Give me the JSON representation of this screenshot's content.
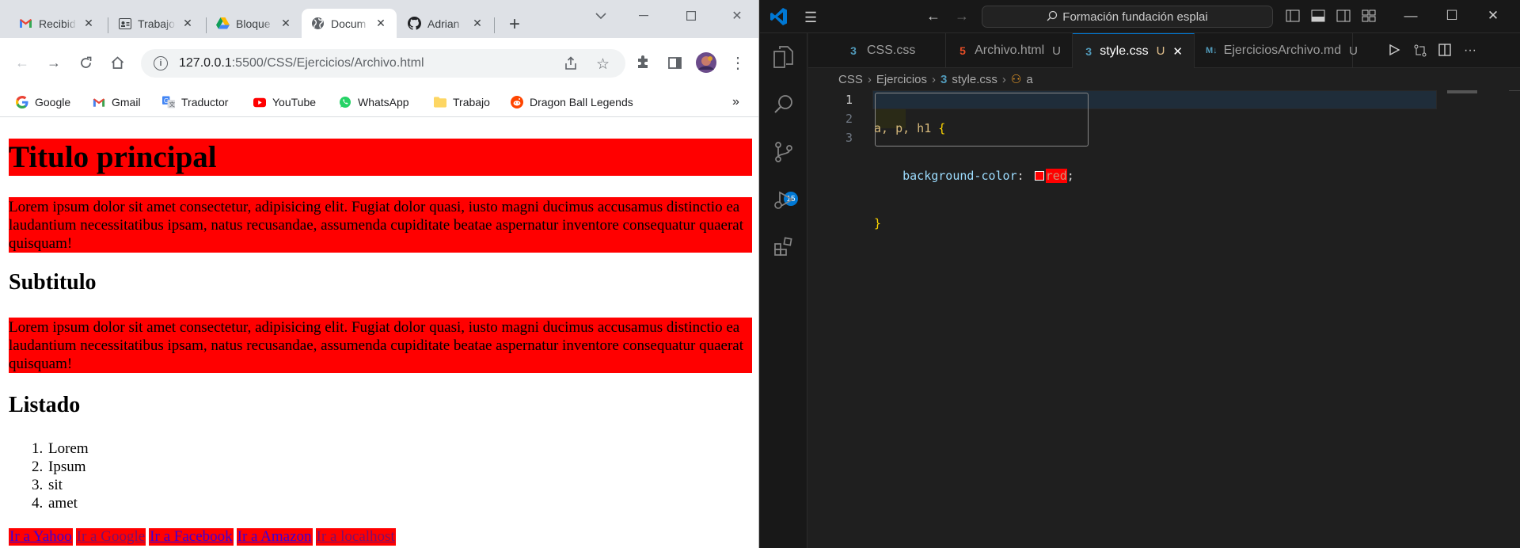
{
  "chrome": {
    "tabs": [
      {
        "title": "Recibid",
        "icon": "gmail-icon"
      },
      {
        "title": "Trabajo",
        "icon": "contact-icon"
      },
      {
        "title": "Bloque",
        "icon": "drive-icon"
      },
      {
        "title": "Docum",
        "icon": "globe-icon",
        "active": true
      },
      {
        "title": "Adrian",
        "icon": "github-icon"
      }
    ],
    "new_tab": "+",
    "url_host": "127.0.0.1",
    "url_rest": ":5500/CSS/Ejercicios/Archivo.html",
    "bookmarks": [
      {
        "label": "Google",
        "icon": "google-icon"
      },
      {
        "label": "Gmail",
        "icon": "gmail-icon"
      },
      {
        "label": "Traductor",
        "icon": "translate-icon"
      },
      {
        "label": "YouTube",
        "icon": "youtube-icon"
      },
      {
        "label": "WhatsApp",
        "icon": "whatsapp-icon"
      },
      {
        "label": "Trabajo",
        "icon": "folder-icon"
      },
      {
        "label": "Dragon Ball Legends",
        "icon": "reddit-icon"
      }
    ],
    "bookmarks_more": "»"
  },
  "page": {
    "h1": "Titulo principal",
    "p1": "Lorem ipsum dolor sit amet consectetur, adipisicing elit. Fugiat dolor quasi, iusto magni ducimus accusamus distinctio ea laudantium necessitatibus ipsam, natus recusandae, assumenda cupiditate beatae aspernatur inventore consequatur quaerat quisquam!",
    "h2a": "Subtitulo",
    "p2": "Lorem ipsum dolor sit amet consectetur, adipisicing elit. Fugiat dolor quasi, iusto magni ducimus accusamus distinctio ea laudantium necessitatibus ipsam, natus recusandae, assumenda cupiditate beatae aspernatur inventore consequatur quaerat quisquam!",
    "h2b": "Listado",
    "list": [
      {
        "num": "1.",
        "text": "Lorem"
      },
      {
        "num": "2.",
        "text": "Ipsum"
      },
      {
        "num": "3.",
        "text": "sit"
      },
      {
        "num": "4.",
        "text": "amet"
      }
    ],
    "links": [
      {
        "text": "Ir a Yahoo",
        "visited": false
      },
      {
        "text": "Ir a Google",
        "visited": true
      },
      {
        "text": "Ir a Facebook",
        "visited": false
      },
      {
        "text": "Ir a Amazon",
        "visited": false
      },
      {
        "text": "Ir a localhost",
        "visited": true
      }
    ]
  },
  "vscode": {
    "search": "Formación fundación esplai",
    "tabs": [
      {
        "label": "CSS.css",
        "icon_glyph": "3",
        "icon_color": "#519aba",
        "modified": ""
      },
      {
        "label": "Archivo.html",
        "icon_glyph": "5",
        "icon_color": "#e44d26",
        "modified": "U"
      },
      {
        "label": "style.css",
        "icon_glyph": "3",
        "icon_color": "#519aba",
        "modified": "U",
        "active": true
      },
      {
        "label": "EjerciciosArchivo.md",
        "icon_glyph": "M↓",
        "icon_color": "#519aba",
        "modified": "U"
      }
    ],
    "breadcrumbs": {
      "c1": "CSS",
      "c2": "Ejercicios",
      "c3": "style.css",
      "c4": "a"
    },
    "scm_badge": "15",
    "line_numbers": [
      "1",
      "2",
      "3"
    ],
    "code": {
      "selector": "a, p, h1 ",
      "open": "{",
      "indent": "    ",
      "property": "background-color",
      "colon": ": ",
      "value": "red",
      "semi": ";",
      "close": "}"
    }
  }
}
